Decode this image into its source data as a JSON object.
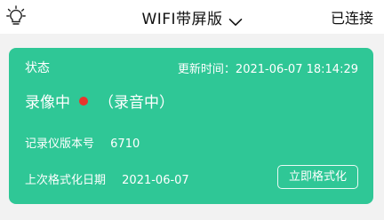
{
  "header": {
    "icon": "lightbulb-icon",
    "title": "WIFI带屏版",
    "dropdown_icon": "chevron-down-icon",
    "connection_status": "已连接"
  },
  "card": {
    "background_color": "#2fc796",
    "status_label": "状态",
    "update_time": "更新时间：2021-06-07 18:14:29",
    "recording_status": "录像中",
    "recording_indicator_color": "#e8352d",
    "audio_status": "（录音中）",
    "version_label": "记录仪版本号",
    "version_value": "6710",
    "last_format_label": "上次格式化日期",
    "last_format_value": "2021-06-07",
    "format_button_label": "立即格式化"
  }
}
